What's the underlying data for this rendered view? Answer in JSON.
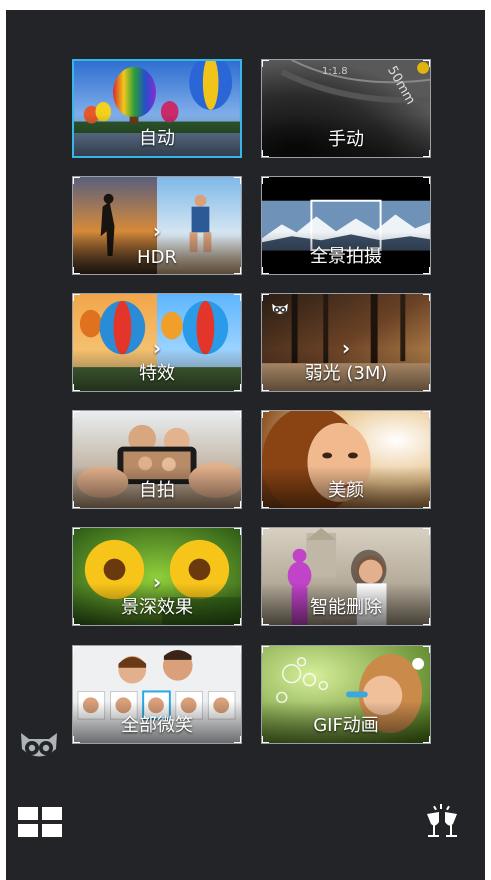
{
  "modes": [
    {
      "id": "auto",
      "label": "自动",
      "selected": true
    },
    {
      "id": "manual",
      "label": "手动",
      "selected": false
    },
    {
      "id": "hdr",
      "label": "HDR",
      "selected": false
    },
    {
      "id": "panorama",
      "label": "全景拍摄",
      "selected": false
    },
    {
      "id": "effects",
      "label": "特效",
      "selected": false
    },
    {
      "id": "lowlight",
      "label": "弱光 (3M)",
      "selected": false
    },
    {
      "id": "selfie",
      "label": "自拍",
      "selected": false
    },
    {
      "id": "beautify",
      "label": "美颜",
      "selected": false
    },
    {
      "id": "depth",
      "label": "景深效果",
      "selected": false
    },
    {
      "id": "smartremove",
      "label": "智能删除",
      "selected": false
    },
    {
      "id": "allsmiles",
      "label": "全部微笑",
      "selected": false
    },
    {
      "id": "gif",
      "label": "GIF动画",
      "selected": false
    }
  ],
  "lens_text": {
    "aperture": "1:1.8",
    "focal": "50mm"
  },
  "icons": {
    "owl": "owl-icon",
    "grid": "grid-view-icon",
    "cheers": "cheers-glasses-icon"
  },
  "colors": {
    "background": "#232427",
    "selected_border": "#35b8e8",
    "tile_border": "#9aa0a6"
  }
}
